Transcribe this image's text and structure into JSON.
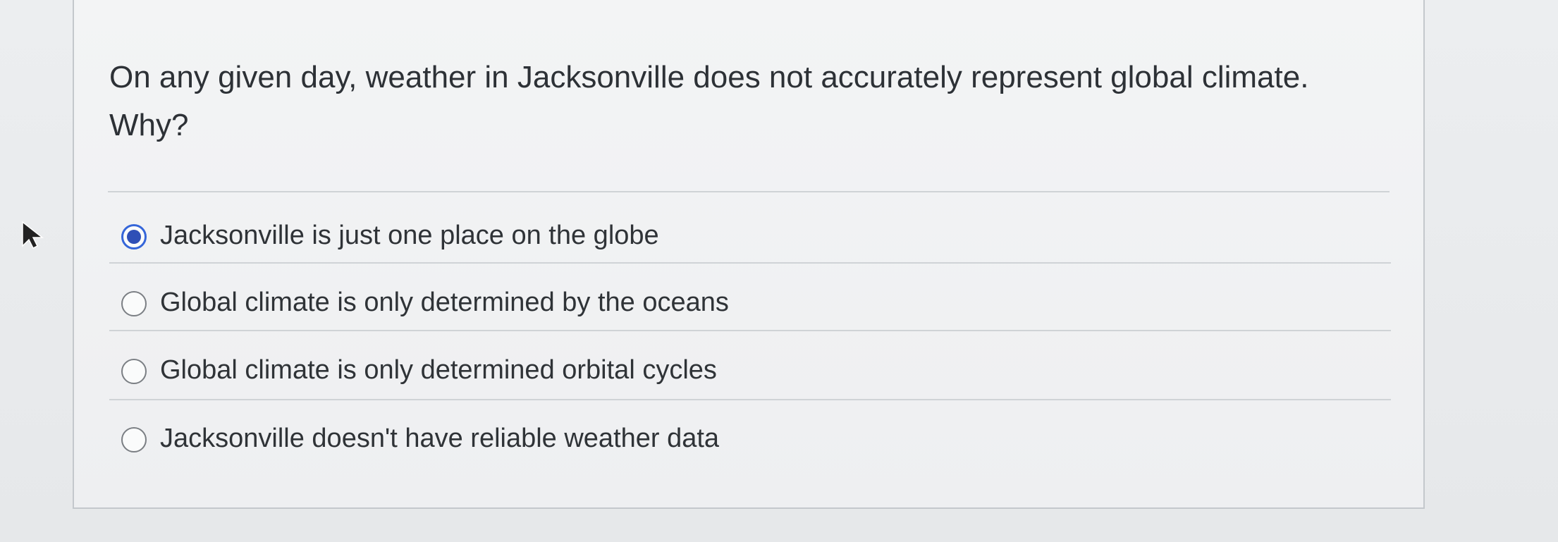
{
  "question": {
    "prompt": "On any given day, weather in Jacksonville does not accurately represent global climate. Why?"
  },
  "answers": [
    {
      "label": "Jacksonville is just one place on the globe",
      "selected": true
    },
    {
      "label": "Global climate is only determined by the oceans",
      "selected": false
    },
    {
      "label": "Global climate is only determined orbital cycles",
      "selected": false
    },
    {
      "label": "Jacksonville doesn't have reliable weather data",
      "selected": false
    }
  ],
  "icons": {
    "cursor": "mouse-pointer-icon"
  },
  "colors": {
    "selected_radio": "#3566d9",
    "selected_radio_dot": "#2f4fb6",
    "text": "#2f3337",
    "divider": "#cfd3d6"
  }
}
